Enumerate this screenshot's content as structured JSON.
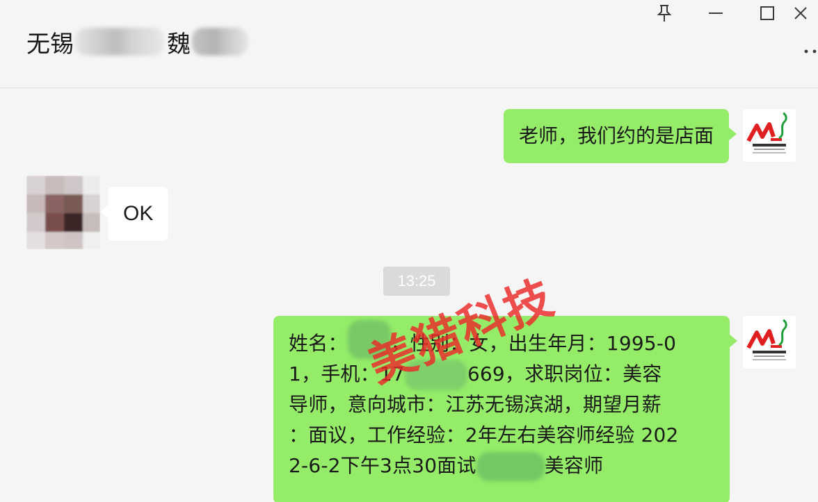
{
  "header": {
    "title_prefix": "无锡",
    "title_suffix": "魏"
  },
  "window_controls": {
    "pin_icon": "pin-icon",
    "minimize_icon": "minimize-icon",
    "maximize_icon": "maximize-icon",
    "close_icon": "close-icon",
    "more_icon": "more-icon"
  },
  "messages": [
    {
      "side": "right",
      "text": "老师，我们约的是店面"
    },
    {
      "side": "left",
      "text": "OK"
    },
    {
      "type": "time",
      "text": "13:25"
    },
    {
      "side": "right",
      "lines": [
        {
          "a": "姓名：",
          "b": "，性别：女，出生年月：1995-0"
        },
        {
          "a": "1，手机：17",
          "b": "669，求职岗位：美容"
        },
        {
          "a": "导师，意向城市：江苏无锡滨湖，期望月薪"
        },
        {
          "a": "：面议，工作经验：2年左右美容师经验 202"
        },
        {
          "a": "2-6-2下午3点30面试",
          "b": "美容师"
        }
      ]
    }
  ],
  "avatar": {
    "brand_text": "美猎客服1",
    "url_text": "www.meilieweng.com"
  },
  "watermark": "美猎科技",
  "colors": {
    "sent_bubble": "#95ec69",
    "received_bubble": "#ffffff",
    "background": "#f5f5f5",
    "watermark": "#eb2828"
  }
}
